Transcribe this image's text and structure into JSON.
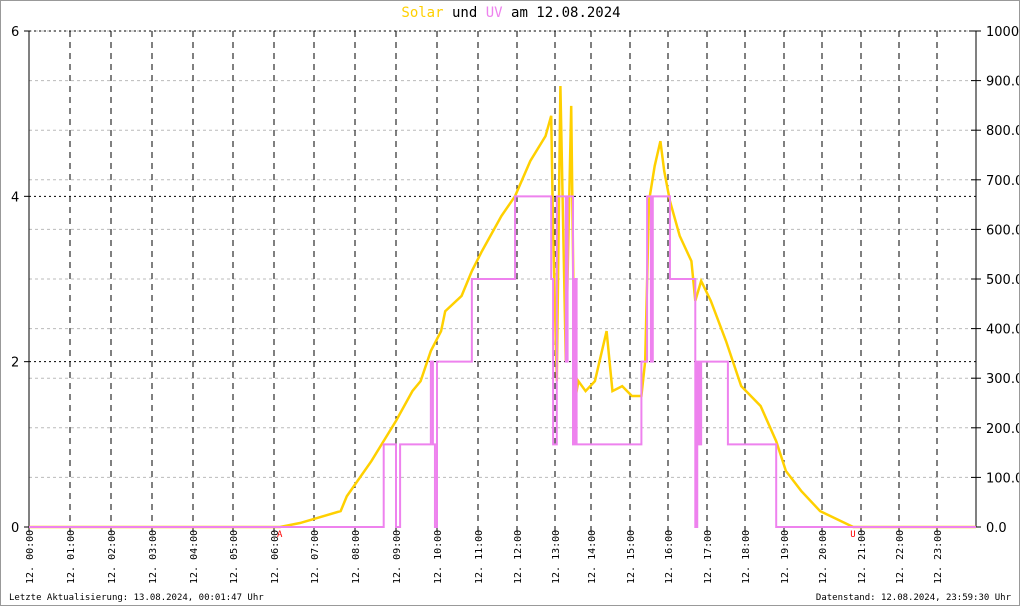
{
  "title": {
    "solar": "Solar",
    "und": "und",
    "uv": "UV",
    "rest": "am 12.08.2024"
  },
  "footer": {
    "left": "Letzte Aktualisierung: 13.08.2024, 00:01:47 Uhr",
    "right": "Datenstand: 12.08.2024, 23:59:30 Uhr"
  },
  "chart_data": {
    "type": "line",
    "title": "Solar und UV am 12.08.2024",
    "colors": {
      "solar": "#ffd000",
      "uv": "#ee82ee",
      "marker": "#ff0000"
    },
    "x_tick_labels": [
      "12. 00:00",
      "12. 01:00",
      "12. 02:00",
      "12. 03:00",
      "12. 04:00",
      "12. 05:00",
      "12. 06:00",
      "12. 07:00",
      "12. 08:00",
      "12. 09:00",
      "12. 10:00",
      "12. 11:00",
      "12. 12:00",
      "12. 13:00",
      "12. 14:00",
      "12. 15:00",
      "12. 16:00",
      "12. 17:00",
      "12. 18:00",
      "12. 19:00",
      "12. 20:00",
      "12. 21:00",
      "12. 22:00",
      "12. 23:00"
    ],
    "y_left": {
      "label": "UV",
      "range": [
        0,
        6
      ],
      "ticks": [
        "0",
        "2",
        "4",
        "6"
      ]
    },
    "y_right": {
      "label": "Solar",
      "range": [
        0,
        1000
      ],
      "ticks": [
        "0.0",
        "100.0",
        "200.0",
        "300.0",
        "400.0",
        "500.0",
        "600.0",
        "700.0",
        "800.0",
        "900.0",
        "1000"
      ]
    },
    "markers": [
      {
        "label": "A",
        "hour": 6.15
      },
      {
        "label": "U",
        "hour": 20.8
      }
    ],
    "series": [
      {
        "name": "Solar",
        "axis": "right",
        "points": [
          [
            0,
            0
          ],
          [
            6.15,
            0
          ],
          [
            6.65,
            8
          ],
          [
            7.65,
            32
          ],
          [
            7.8,
            62
          ],
          [
            8.4,
            133
          ],
          [
            9.0,
            214
          ],
          [
            9.4,
            274
          ],
          [
            9.6,
            294
          ],
          [
            9.85,
            355
          ],
          [
            10.1,
            395
          ],
          [
            10.2,
            435
          ],
          [
            10.6,
            466
          ],
          [
            10.85,
            516
          ],
          [
            11.1,
            556
          ],
          [
            11.6,
            627
          ],
          [
            11.95,
            667
          ],
          [
            12.35,
            738
          ],
          [
            12.75,
            788
          ],
          [
            12.9,
            829
          ],
          [
            12.95,
            597
          ],
          [
            13.05,
            294
          ],
          [
            13.15,
            889
          ],
          [
            13.3,
            335
          ],
          [
            13.45,
            849
          ],
          [
            13.55,
            254
          ],
          [
            13.65,
            294
          ],
          [
            13.85,
            274
          ],
          [
            14.1,
            294
          ],
          [
            14.4,
            395
          ],
          [
            14.55,
            274
          ],
          [
            14.8,
            284
          ],
          [
            15.05,
            264
          ],
          [
            15.3,
            264
          ],
          [
            15.4,
            335
          ],
          [
            15.5,
            657
          ],
          [
            15.65,
            728
          ],
          [
            15.8,
            778
          ],
          [
            15.9,
            718
          ],
          [
            16.05,
            657
          ],
          [
            16.3,
            587
          ],
          [
            16.6,
            536
          ],
          [
            16.7,
            456
          ],
          [
            16.85,
            496
          ],
          [
            17.1,
            456
          ],
          [
            17.5,
            375
          ],
          [
            17.9,
            284
          ],
          [
            18.15,
            264
          ],
          [
            18.4,
            244
          ],
          [
            18.8,
            173
          ],
          [
            19.05,
            113
          ],
          [
            19.45,
            73
          ],
          [
            19.95,
            32
          ],
          [
            20.8,
            0
          ],
          [
            24,
            0
          ]
        ]
      },
      {
        "name": "UV",
        "axis": "left",
        "step": true,
        "points": [
          [
            0,
            0
          ],
          [
            8.7,
            1
          ],
          [
            9.0,
            0
          ],
          [
            9.1,
            1
          ],
          [
            9.85,
            2
          ],
          [
            9.9,
            1
          ],
          [
            9.95,
            0
          ],
          [
            10.0,
            2
          ],
          [
            10.85,
            3
          ],
          [
            11.95,
            4
          ],
          [
            12.9,
            3
          ],
          [
            12.95,
            1
          ],
          [
            13.05,
            4
          ],
          [
            13.3,
            2
          ],
          [
            13.35,
            4
          ],
          [
            13.5,
            1
          ],
          [
            13.55,
            3
          ],
          [
            13.6,
            1
          ],
          [
            15.3,
            2
          ],
          [
            15.45,
            4
          ],
          [
            15.55,
            2
          ],
          [
            15.6,
            4
          ],
          [
            16.05,
            3
          ],
          [
            16.7,
            0
          ],
          [
            16.75,
            2
          ],
          [
            16.8,
            1
          ],
          [
            16.85,
            2
          ],
          [
            17.55,
            1
          ],
          [
            18.8,
            0
          ],
          [
            24,
            0
          ]
        ]
      }
    ]
  }
}
